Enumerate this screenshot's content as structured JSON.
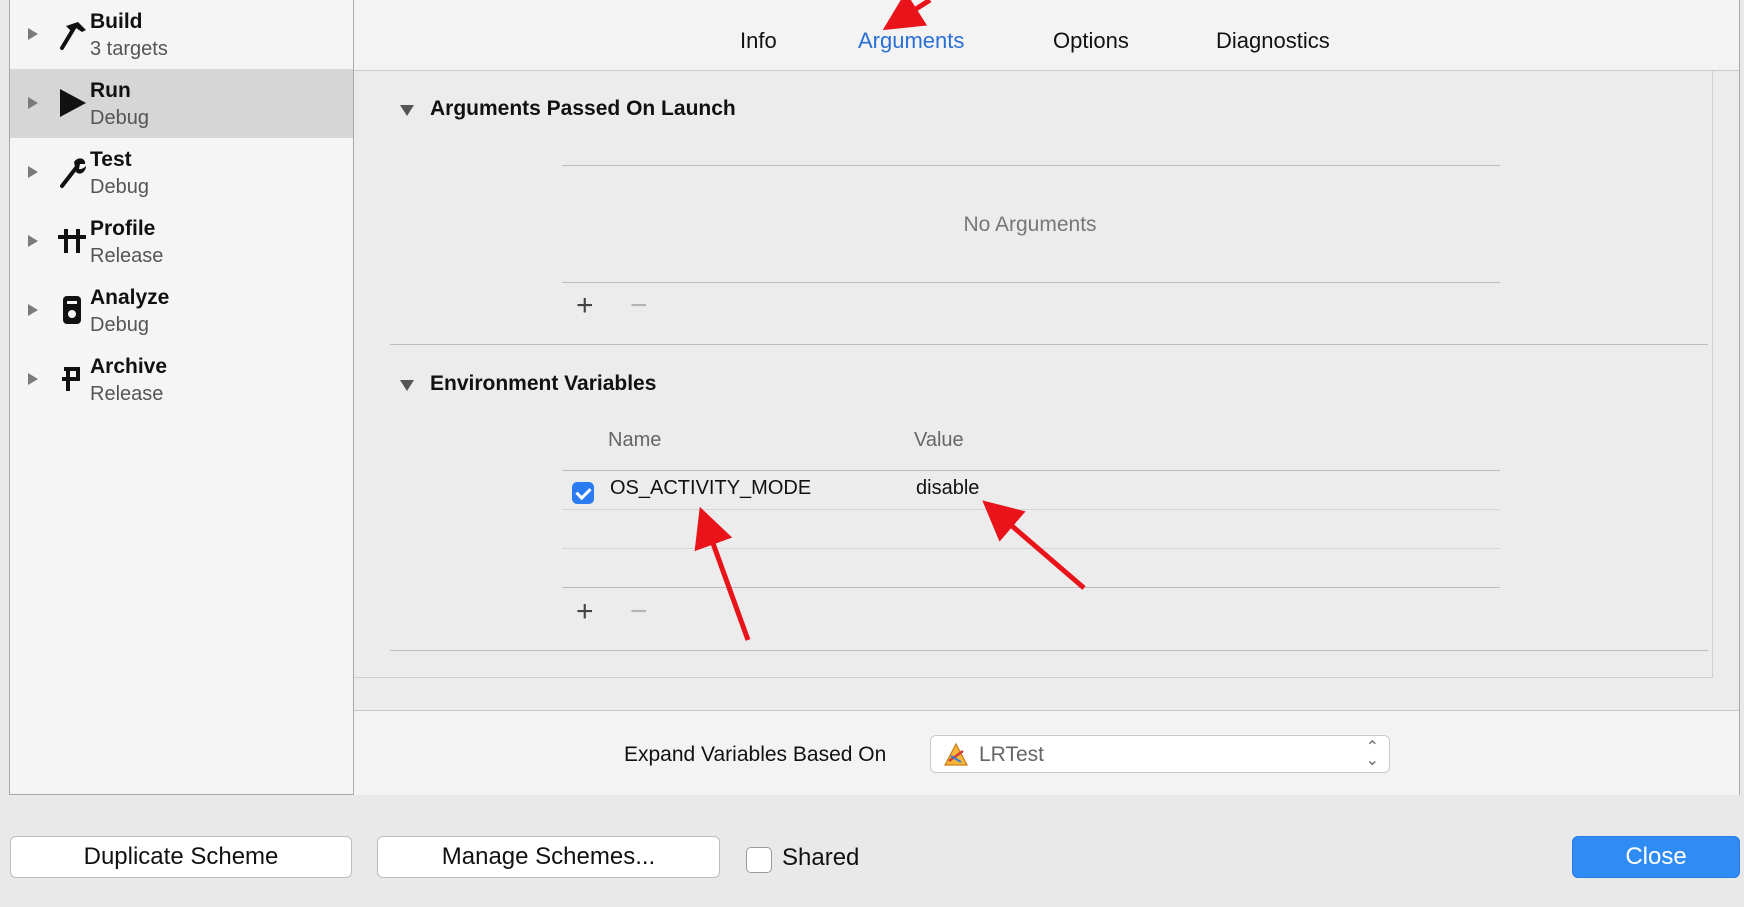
{
  "sidebar": {
    "items": [
      {
        "title": "Build",
        "subtitle": "3 targets",
        "icon": "hammer-icon"
      },
      {
        "title": "Run",
        "subtitle": "Debug",
        "icon": "play-icon",
        "selected": true
      },
      {
        "title": "Test",
        "subtitle": "Debug",
        "icon": "wrench-icon"
      },
      {
        "title": "Profile",
        "subtitle": "Release",
        "icon": "instruments-icon"
      },
      {
        "title": "Analyze",
        "subtitle": "Debug",
        "icon": "analyze-icon"
      },
      {
        "title": "Archive",
        "subtitle": "Release",
        "icon": "archive-icon"
      }
    ]
  },
  "tabs": [
    "Info",
    "Arguments",
    "Options",
    "Diagnostics"
  ],
  "active_tab": "Arguments",
  "arguments_section": {
    "title": "Arguments Passed On Launch",
    "empty_text": "No Arguments",
    "add_label": "+",
    "remove_label": "−"
  },
  "env_section": {
    "title": "Environment Variables",
    "col_name": "Name",
    "col_value": "Value",
    "rows": [
      {
        "enabled": true,
        "name": "OS_ACTIVITY_MODE",
        "value": "disable"
      }
    ],
    "add_label": "+",
    "remove_label": "−"
  },
  "expand": {
    "label": "Expand Variables Based On",
    "selected": "LRTest",
    "selected_icon": "app-target-icon"
  },
  "footer": {
    "duplicate_label": "Duplicate Scheme",
    "manage_label": "Manage Schemes...",
    "shared_label": "Shared",
    "shared_checked": false,
    "close_label": "Close"
  },
  "colors": {
    "accent": "#2a6fd6",
    "close_button": "#2f8cf4",
    "annotation_arrow": "#e8141a"
  }
}
